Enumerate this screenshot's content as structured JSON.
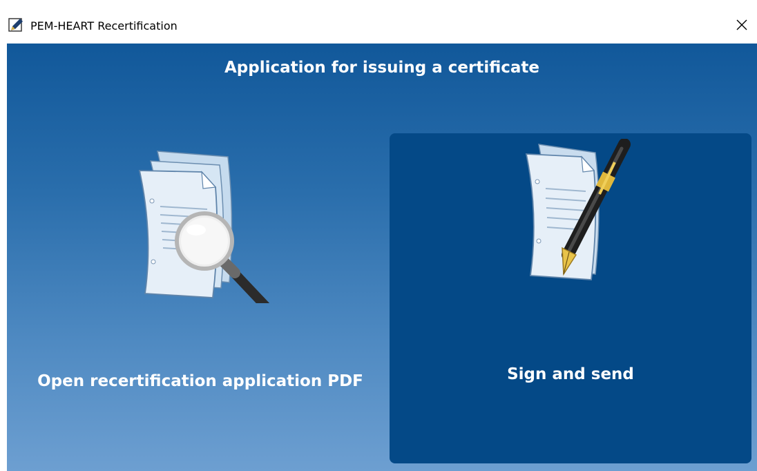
{
  "window": {
    "title": "PEM-HEART Recertification",
    "app_icon": "pen-document-icon",
    "close_icon": "close-icon"
  },
  "main": {
    "heading": "Application for issuing a certificate",
    "tiles": [
      {
        "label": "Open recertification application PDF",
        "icon": "documents-magnifier-icon"
      },
      {
        "label": "Sign and send",
        "icon": "documents-pen-icon"
      }
    ]
  },
  "colors": {
    "background_top": "#11589a",
    "background_bottom": "#6d9fd1",
    "selected_tile": "#044987",
    "text": "#ffffff"
  }
}
